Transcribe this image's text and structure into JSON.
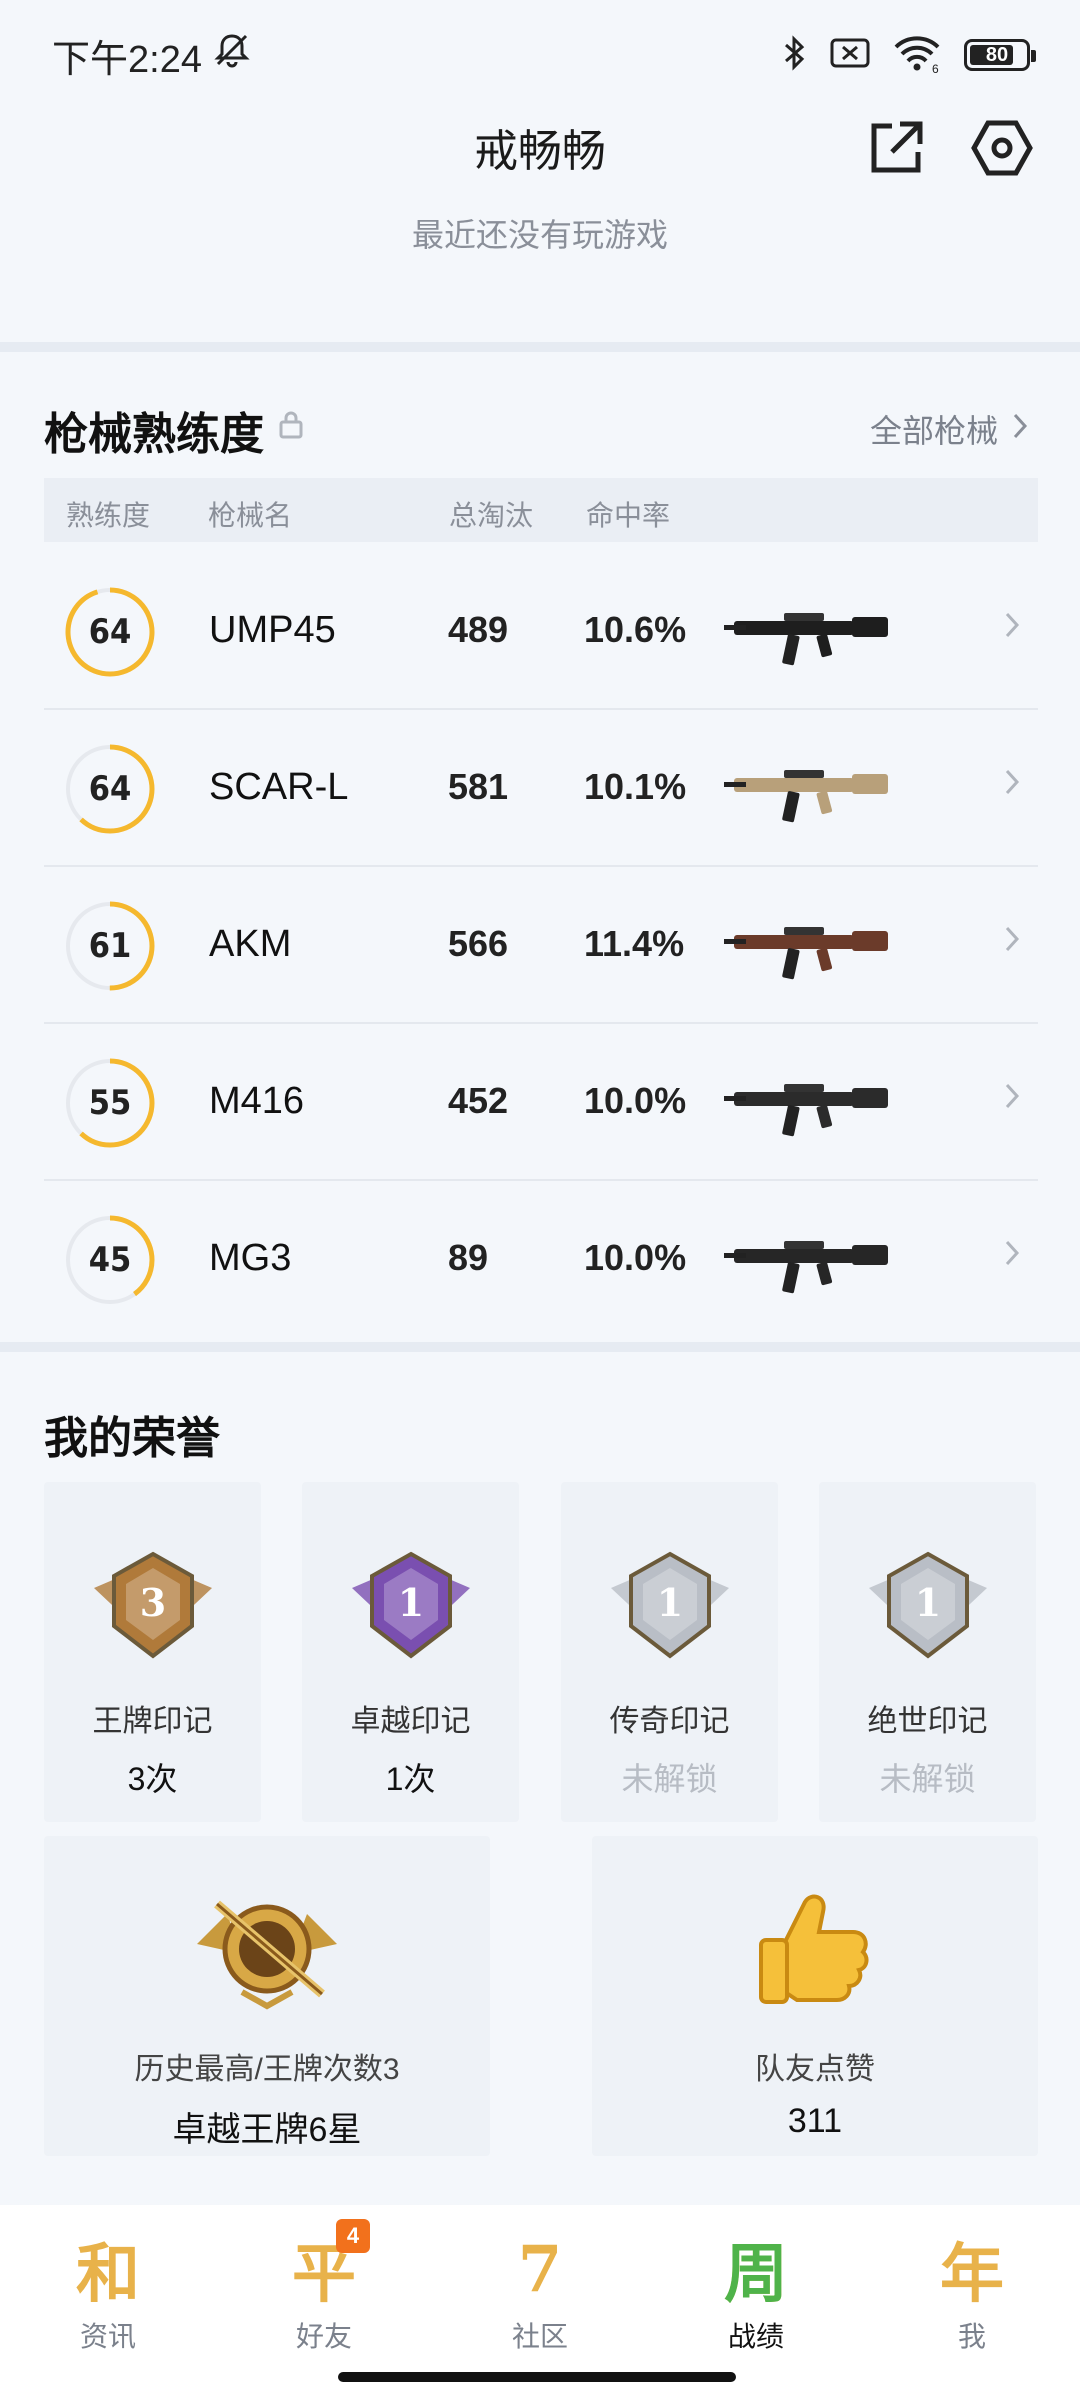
{
  "status_bar": {
    "time": "下午2:24",
    "battery": "80",
    "wifi_sub": "6"
  },
  "header": {
    "title": "戒畅畅",
    "subtitle": "最近还没有玩游戏"
  },
  "guns": {
    "title": "枪械熟练度",
    "all_link": "全部枪械",
    "columns": {
      "proficiency": "熟练度",
      "name": "枪械名",
      "kills": "总淘汰",
      "hit_rate": "命中率"
    },
    "rows": [
      {
        "proficiency": "64",
        "proficiency_fraction": 0.95,
        "name": "UMP45",
        "kills": "489",
        "hit_rate": "10.6%",
        "gun_color": "#1e1e1e"
      },
      {
        "proficiency": "64",
        "proficiency_fraction": 0.62,
        "name": "SCAR-L",
        "kills": "581",
        "hit_rate": "10.1%",
        "gun_color": "#b8a07a"
      },
      {
        "proficiency": "61",
        "proficiency_fraction": 0.5,
        "name": "AKM",
        "kills": "566",
        "hit_rate": "11.4%",
        "gun_color": "#6b3b2a"
      },
      {
        "proficiency": "55",
        "proficiency_fraction": 0.62,
        "name": "M416",
        "kills": "452",
        "hit_rate": "10.0%",
        "gun_color": "#2b2b2b"
      },
      {
        "proficiency": "45",
        "proficiency_fraction": 0.4,
        "name": "MG3",
        "kills": "89",
        "hit_rate": "10.0%",
        "gun_color": "#262626"
      }
    ]
  },
  "honors": {
    "title": "我的荣誉",
    "cards": [
      {
        "label": "王牌印记",
        "value": "3次",
        "locked": false,
        "badge_number": "3",
        "badge_color": "#b07a3a"
      },
      {
        "label": "卓越印记",
        "value": "1次",
        "locked": false,
        "badge_number": "1",
        "badge_color": "#7a4fb0"
      },
      {
        "label": "传奇印记",
        "value": "未解锁",
        "locked": true,
        "badge_number": "1",
        "badge_color": "#b9bec6"
      },
      {
        "label": "绝世印记",
        "value": "未解锁",
        "locked": true,
        "badge_number": "1",
        "badge_color": "#b9bec6"
      }
    ],
    "best": {
      "label": "历史最高/王牌次数3",
      "value": "卓越王牌6星"
    },
    "likes": {
      "label": "队友点赞",
      "value": "311"
    }
  },
  "nav": {
    "items": [
      {
        "glyph": "和",
        "label": "资讯",
        "active": false,
        "badge": ""
      },
      {
        "glyph": "平",
        "label": "好友",
        "active": false,
        "badge": "4"
      },
      {
        "glyph": "7",
        "label": "社区",
        "active": false,
        "badge": ""
      },
      {
        "glyph": "周",
        "label": "战绩",
        "active": true,
        "badge": ""
      },
      {
        "glyph": "年",
        "label": "我",
        "active": false,
        "badge": ""
      }
    ]
  },
  "colors": {
    "accent": "#f5b82e",
    "ring_track": "#e6e9ee",
    "background": "#f4f7fb"
  }
}
